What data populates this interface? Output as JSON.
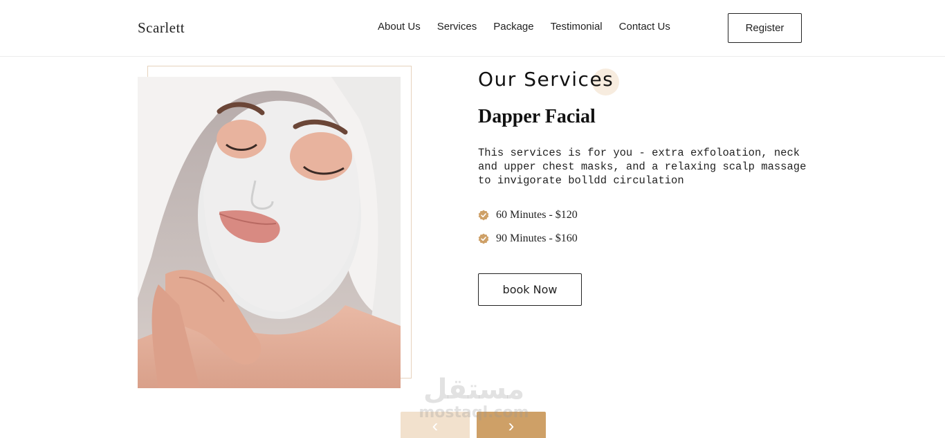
{
  "header": {
    "logo": "Scarlett",
    "nav": [
      {
        "label": "About Us"
      },
      {
        "label": "Services"
      },
      {
        "label": "Package"
      },
      {
        "label": "Testimonial"
      },
      {
        "label": "Contact Us"
      }
    ],
    "register_label": "Register"
  },
  "services": {
    "title": "Our Services",
    "service_name": "Dapper Facial",
    "description": "This services is for you - extra exfoloation, neck and upper chest masks, and a relaxing scalp massage to invigorate bolldd circulation",
    "prices": [
      {
        "text": "60 Minutes - $120",
        "icon": "check-badge-icon"
      },
      {
        "text": "90 Minutes - $160",
        "icon": "check-badge-icon"
      }
    ],
    "book_label": "book Now"
  },
  "carousel": {
    "prev_icon": "chevron-left-icon",
    "next_icon": "chevron-right-icon",
    "prev_glyph": "‹",
    "next_glyph": "›"
  },
  "watermark": {
    "arabic": "مستقل",
    "latin": "mostaql.com"
  },
  "colors": {
    "accent": "#cea067",
    "accent_light": "#f2e1cd",
    "frame": "#e6d2bd"
  }
}
